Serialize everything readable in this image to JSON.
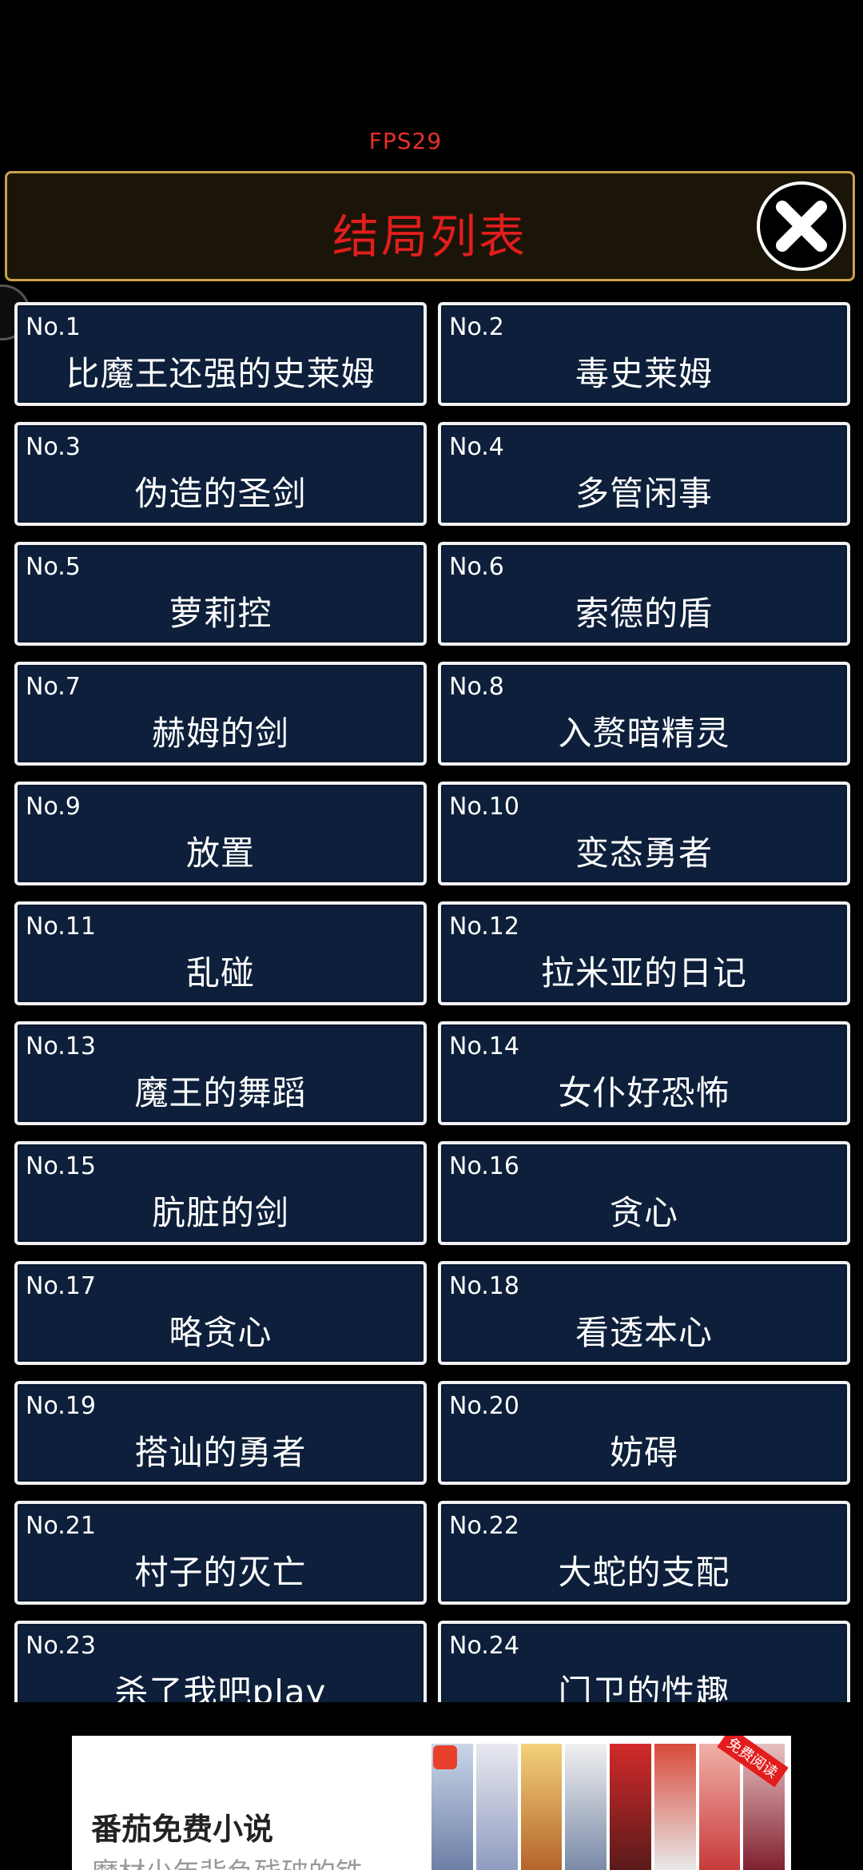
{
  "fps": "FPS29",
  "header": {
    "title": "结局列表"
  },
  "endings": [
    {
      "num": "No.1",
      "name": "比魔王还强的史莱姆"
    },
    {
      "num": "No.2",
      "name": "毒史莱姆"
    },
    {
      "num": "No.3",
      "name": "伪造的圣剑"
    },
    {
      "num": "No.4",
      "name": "多管闲事"
    },
    {
      "num": "No.5",
      "name": "萝莉控"
    },
    {
      "num": "No.6",
      "name": "索德的盾"
    },
    {
      "num": "No.7",
      "name": "赫姆的剑"
    },
    {
      "num": "No.8",
      "name": "入赘暗精灵"
    },
    {
      "num": "No.9",
      "name": "放置"
    },
    {
      "num": "No.10",
      "name": "变态勇者"
    },
    {
      "num": "No.11",
      "name": "乱碰"
    },
    {
      "num": "No.12",
      "name": "拉米亚的日记"
    },
    {
      "num": "No.13",
      "name": "魔王的舞蹈"
    },
    {
      "num": "No.14",
      "name": "女仆好恐怖"
    },
    {
      "num": "No.15",
      "name": "肮脏的剑"
    },
    {
      "num": "No.16",
      "name": "贪心"
    },
    {
      "num": "No.17",
      "name": "略贪心"
    },
    {
      "num": "No.18",
      "name": "看透本心"
    },
    {
      "num": "No.19",
      "name": "搭讪的勇者"
    },
    {
      "num": "No.20",
      "name": "妨碍"
    },
    {
      "num": "No.21",
      "name": "村子的灭亡"
    },
    {
      "num": "No.22",
      "name": "大蛇的支配"
    },
    {
      "num": "No.23",
      "name": "杀了我吧play"
    },
    {
      "num": "No.24",
      "name": "门卫的性趣"
    }
  ],
  "ad": {
    "title": "番茄免费小说",
    "subtitle": "魔材少年背负残破的铁",
    "tag": "免费阅读"
  },
  "colors": {
    "card_bg": "#0d1f3a",
    "title_red": "#e21d1d",
    "header_border": "#c9a24a"
  }
}
